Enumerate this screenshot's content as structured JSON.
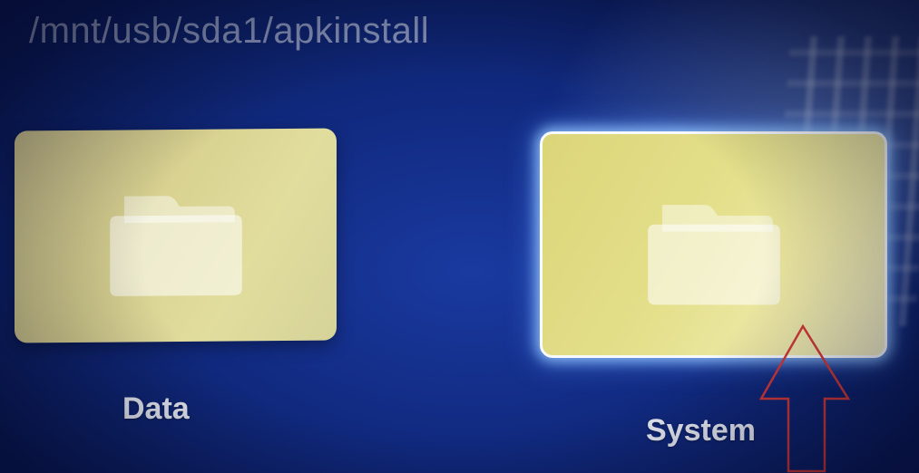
{
  "header": {
    "path": "/mnt/usb/sda1/apkinstall"
  },
  "folders": [
    {
      "label": "Data",
      "icon": "folder-icon",
      "selected": false
    },
    {
      "label": "System",
      "icon": "folder-icon",
      "selected": true
    }
  ],
  "annotation": {
    "icon": "up-arrow-icon",
    "color": "#d23a3a"
  },
  "colors": {
    "background": "#112a80",
    "tile": "#d8d190",
    "selected_outline": "#f7fbff"
  }
}
